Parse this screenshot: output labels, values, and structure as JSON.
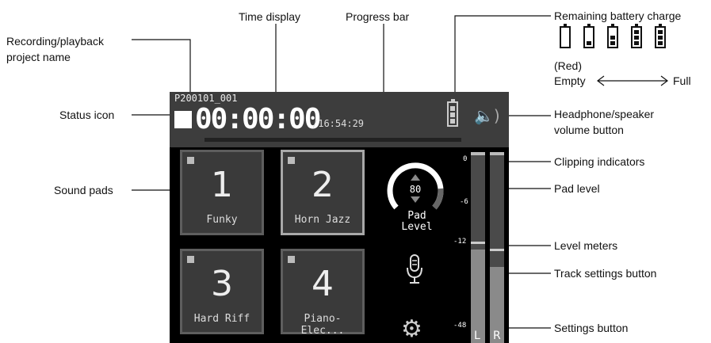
{
  "callouts": {
    "recording_project_name": "Recording/playback\nproject name",
    "time_display": "Time display",
    "progress_bar": "Progress bar",
    "remaining_battery": "Remaining battery charge",
    "battery_red": "(Red)",
    "battery_empty": "Empty",
    "battery_full": "Full",
    "status_icon": "Status icon",
    "headphone_volume": "Headphone/speaker\nvolume button",
    "clipping_indicators": "Clipping indicators",
    "sound_pads": "Sound pads",
    "pad_level": "Pad level",
    "level_meters": "Level meters",
    "track_settings": "Track settings button",
    "settings_button": "Settings button"
  },
  "screen": {
    "project_name": "P200101_001",
    "time": "00:00:00",
    "remaining_time": "/16:54:29",
    "progress_fraction": 0.0,
    "pads": [
      {
        "number": "1",
        "name": "Funky",
        "selected": false
      },
      {
        "number": "2",
        "name": "Horn Jazz",
        "selected": true
      },
      {
        "number": "3",
        "name": "Hard Riff",
        "selected": false
      },
      {
        "number": "4",
        "name": "Piano-Elec...",
        "selected": false
      }
    ],
    "pad_level_value": "80",
    "pad_level_label": "Pad\nLevel",
    "meter_scale": [
      "0",
      "-6",
      "-12",
      "-48"
    ],
    "meter_channels": [
      "L",
      "R"
    ],
    "meter_level_fraction": [
      0.49,
      0.4
    ],
    "meter_peak_fraction": [
      0.52,
      0.48
    ],
    "icons": {
      "status": "stop-square-icon",
      "battery": "battery-icon",
      "volume": "speaker-icon",
      "track": "microphone-icon",
      "settings": "gear-icon"
    }
  },
  "colors": {
    "screen_bg": "#000000",
    "header_bg": "#3d3d3d",
    "pad_bg": "#3a3a3a",
    "pad_selected_border": "#a8a8a8"
  }
}
